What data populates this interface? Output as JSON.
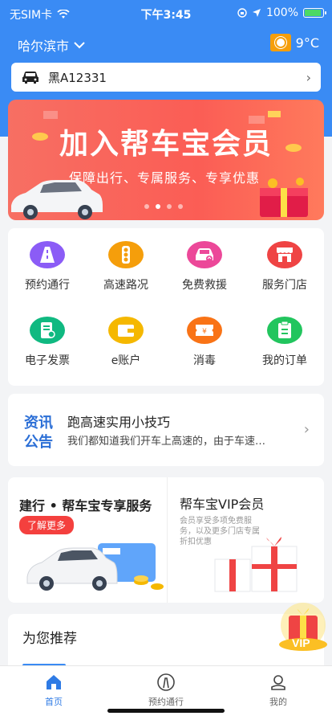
{
  "status": {
    "carrier": "无SIM卡",
    "time": "下午3:45",
    "battery": "100%"
  },
  "header": {
    "city": "哈尔滨市",
    "temperature": "9°C",
    "plate": "黑A12331"
  },
  "banner": {
    "title": "加入帮车宝会员",
    "subtitle": "保障出行、专属服务、专享优惠",
    "slide_index": 2,
    "slide_count": 4
  },
  "grid": [
    {
      "label": "预约通行",
      "icon": "road-icon",
      "color": "#8b5cf6"
    },
    {
      "label": "高速路况",
      "icon": "traffic-light-icon",
      "color": "#f59e0b"
    },
    {
      "label": "免费救援",
      "icon": "rescue-car-icon",
      "color": "#ec4899"
    },
    {
      "label": "服务门店",
      "icon": "store-icon",
      "color": "#ef4444"
    },
    {
      "label": "电子发票",
      "icon": "invoice-icon",
      "color": "#10b981"
    },
    {
      "label": "e账户",
      "icon": "wallet-icon",
      "color": "#f5b800"
    },
    {
      "label": "消毒",
      "icon": "ticket-icon",
      "color": "#f97316"
    },
    {
      "label": "我的订单",
      "icon": "order-icon",
      "color": "#22c55e"
    }
  ],
  "news": {
    "badge_line1": "资讯",
    "badge_line2": "公告",
    "title": "跑高速实用小技巧",
    "body": "我们都知道我们开车上高速的，由于车速…"
  },
  "promo": {
    "left_title": "建行 • 帮车宝专享服务",
    "left_button": "了解更多",
    "right_title": "帮车宝VIP会员",
    "right_desc": "会员享受多项免费服务，以及更多门店专属折扣优惠",
    "vip_badge": "VIP"
  },
  "recommend": {
    "title": "为您推荐"
  },
  "tabbar": [
    {
      "label": "首页",
      "active": true
    },
    {
      "label": "预约通行",
      "active": false
    },
    {
      "label": "我的",
      "active": false
    }
  ],
  "colors": {
    "primary": "#3a8bf4",
    "banner": "#fb5d55",
    "accent_red": "#f4403e"
  }
}
